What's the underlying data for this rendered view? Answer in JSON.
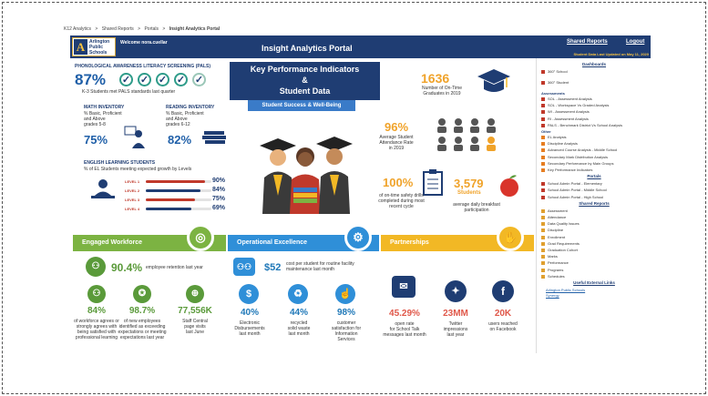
{
  "breadcrumb": [
    "K12 Analytics",
    ">",
    "Shared Reports",
    ">",
    "Portals",
    ">",
    "Insight Analytics Portal"
  ],
  "header": {
    "logo_mark": "A",
    "logo_lines": [
      "Arlington",
      "Public",
      "Schools"
    ],
    "welcome": "Welcome nora.cuellar",
    "title": "Insight Analytics Portal",
    "shared_reports": "Shared Reports",
    "logout": "Logout",
    "updated": "Student Data Last Updated on May 11, 2020"
  },
  "kpi": {
    "title_lines": [
      "Key Performance Indicators",
      "&",
      "Student Data"
    ],
    "subtitle": "Student Success & Well-Being"
  },
  "pals": {
    "title": "PHONOLOGICAL AWARENESS LITERACY SCREENING (PALS)",
    "value": "87%",
    "desc": "K-3 Students met PALS standards last quarter"
  },
  "math": {
    "title": "MATH INVENTORY",
    "desc": [
      "% Basic, Proficient",
      "and Above",
      "grades 5-8"
    ],
    "value": "75%"
  },
  "reading": {
    "title": "READING INVENTORY",
    "desc": [
      "% Basic, Proficient",
      "and Above",
      "grades 6-12"
    ],
    "value": "82%"
  },
  "english": {
    "title": "ENGLISH LEARNING STUDENTS",
    "desc": "% of EL Students meeting expected growth by Levels",
    "levels": [
      {
        "label": "LEVEL 1",
        "value": "90%",
        "fraction": 0.9
      },
      {
        "label": "LEVEL 2",
        "value": "84%",
        "fraction": 0.84
      },
      {
        "label": "LEVEL 3",
        "value": "75%",
        "fraction": 0.75
      },
      {
        "label": "LEVEL 4",
        "value": "69%",
        "fraction": 0.69
      }
    ]
  },
  "grads": {
    "value": "1636",
    "desc": [
      "Number of On-Time",
      "Graduates in 2019"
    ]
  },
  "attendance": {
    "value": "96%",
    "desc": [
      "Average Student",
      "Attendance Rate",
      "in 2019"
    ]
  },
  "safety": {
    "value": "100%",
    "desc": [
      "of on-time safety drills",
      "completed during most",
      "recent cycle"
    ]
  },
  "breakfast": {
    "value": "3,579",
    "unit": "Students",
    "desc": [
      "average daily breakfast",
      "participation"
    ]
  },
  "workforce": {
    "band": "Engaged Workforce",
    "retention_value": "90.4%",
    "retention_desc": "employee retention last year",
    "stats": [
      {
        "value": "84%",
        "desc": [
          "of workforce agrees or",
          "strongly agrees with",
          "being satisfied with",
          "professional learning"
        ]
      },
      {
        "value": "98.7%",
        "desc": [
          "of new employees",
          "identified as exceeding",
          "expectations or meeting",
          "expectations last year"
        ]
      },
      {
        "value": "77,556K",
        "desc": [
          "Staff Central",
          "page visits",
          "last June"
        ]
      }
    ]
  },
  "operational": {
    "band": "Operational Excellence",
    "cost_value": "$52",
    "cost_desc": [
      "cost per student for routine facility",
      "maintenance last month"
    ],
    "stats": [
      {
        "value": "40%",
        "desc": [
          "Electronic",
          "Disbursements",
          "last month"
        ]
      },
      {
        "value": "44%",
        "desc": [
          "recycled",
          "solid waste",
          "last month"
        ]
      },
      {
        "value": "98%",
        "desc": [
          "customer",
          "satisfaction for",
          "Information",
          "Services"
        ]
      }
    ]
  },
  "partnerships": {
    "band": "Partnerships",
    "stats": [
      {
        "value": "45.29%",
        "desc": [
          "open rate",
          "for School Talk",
          "messages last month"
        ]
      },
      {
        "value": "23MM",
        "desc": [
          "Twitter",
          "impressions",
          "last year"
        ]
      },
      {
        "value": "20K",
        "desc": [
          "users reached",
          "on Facebook"
        ]
      }
    ]
  },
  "sidebar": {
    "dashboards_head": "Dashboards",
    "dashboards": [
      "360° School",
      "360° Student"
    ],
    "assessments_head": "Assessments",
    "assessments": [
      "SOL - Assessment Analysis",
      "SOL - Workspace Vs Graded Analysis",
      "WI - Assessment Analysis",
      "RI - Assessment Analysis",
      "PALS - Benchmark District Vs School Analysis"
    ],
    "other_head": "Other",
    "other": [
      "EL Analysis",
      "Discipline Analysis",
      "Advanced Course Analysis - Middle School",
      "Secondary Mark Distribution Analysis",
      "Secondary Performance by Main Groups",
      "Key Performance Indicators"
    ],
    "portals_head": "Portals",
    "portals": [
      "School Admin Portal - Elementary",
      "School Admin Portal - Middle School",
      "School Admin Portal - High School"
    ],
    "shared_head": "Shared Reports",
    "shared": [
      "Assessment",
      "Attendance",
      "Data Quality Issues",
      "Discipline",
      "Enrollment",
      "Grad Requirements",
      "Graduation Cohort",
      "Marks",
      "Performance",
      "Programs",
      "Schedules"
    ],
    "useful_head": "Useful External Links",
    "useful": [
      "Arlington Public Schools",
      "Synergy"
    ]
  },
  "colors": {
    "navy": "#1f3d73",
    "green": "#7cb342",
    "blue": "#2f8fd8",
    "gold": "#f2b825"
  }
}
